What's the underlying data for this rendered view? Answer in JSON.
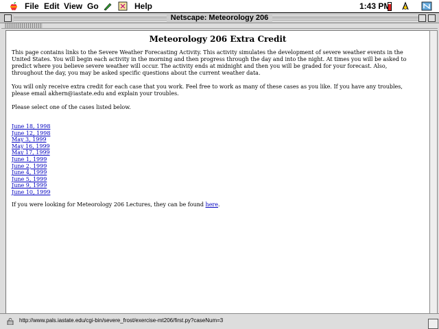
{
  "menubar": {
    "items": [
      "File",
      "Edit",
      "View",
      "Go",
      "Help"
    ],
    "clock": "1:43 PM"
  },
  "window": {
    "title": "Netscape: Meteorology 206"
  },
  "page": {
    "heading": "Meteorology 206 Extra Credit",
    "intro": "This page contains links to the Severe Weather Forecasting Activity. This activity simulates the development of severe weather events in the United States. You will begin each activity in the morning and then progress through the day and into the night. At times you will be asked to predict where you believe severe weather will occur. The activity ends at midnight and then you will be graded for your forecast. Also, throughout the day, you may be asked specific questions about the current weather data.",
    "credit": "You will only receive extra credit for each case that you work. Feel free to work as many of these cases as you like. If you have any troubles, please email akhern@iastate.edu and explain your troubles.",
    "select_prompt": "Please select one of the cases listed below.",
    "cases": [
      "June 18, 1998",
      "June 12, 1998",
      "May 3, 1999",
      "May 16, 1999",
      "May 17, 1999",
      "June 1, 1999",
      "June 2, 1999",
      "June 4, 1999",
      "June 5, 1999",
      "June 9, 1999",
      "June 10, 1999"
    ],
    "footer_prefix": "If you were looking for Meteorology 206 Lectures, they can be found ",
    "footer_link": "here",
    "footer_suffix": "."
  },
  "statusbar": {
    "url": "http://www.pals.iastate.edu/cgi-bin/severe_frost/exercise-mt206/first.py?caseNum=3"
  }
}
